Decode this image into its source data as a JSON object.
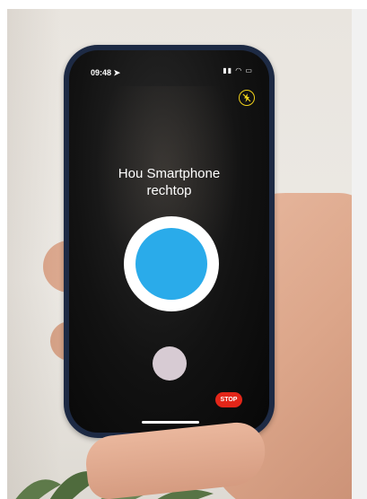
{
  "status": {
    "time": "09:48",
    "icons": "▮▮ ◠ ▭"
  },
  "instruction": {
    "line1": "Hou Smartphone",
    "line2": "rechtop"
  },
  "buttons": {
    "stop_label": "STOP"
  },
  "icons": {
    "flash": "flash-off-icon",
    "location": "location-arrow-icon"
  },
  "colors": {
    "target_blue": "#2aabea",
    "stop_red": "#e32619",
    "flash_yellow": "#f2d21b",
    "phone_frame": "#1d2a44"
  }
}
